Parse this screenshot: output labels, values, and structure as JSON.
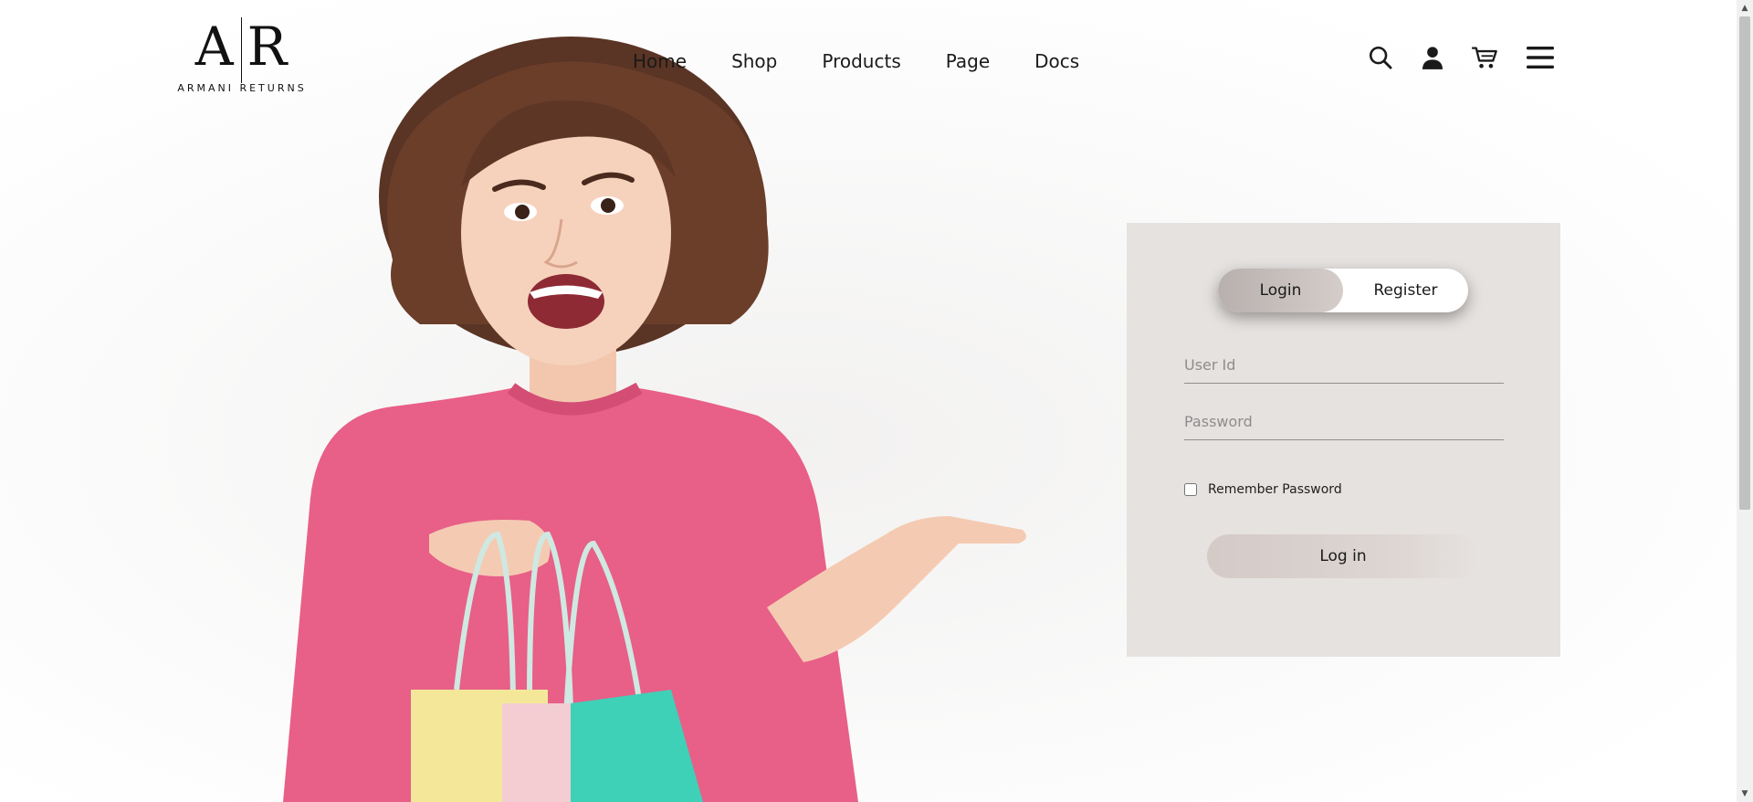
{
  "brand": {
    "mark_left": "A",
    "mark_right": "R",
    "name": "ARMANI RETURNS"
  },
  "nav": {
    "items": [
      "Home",
      "Shop",
      "Products",
      "Page",
      "Docs"
    ]
  },
  "header_icons": [
    "search-icon",
    "user-icon",
    "cart-icon",
    "menu-icon"
  ],
  "login_card": {
    "tabs": {
      "login": "Login",
      "register": "Register",
      "active": "login"
    },
    "user_id": {
      "value": "",
      "placeholder": "User Id"
    },
    "password": {
      "value": "",
      "placeholder": "Password"
    },
    "remember_label": "Remember Password",
    "remember_checked": false,
    "submit_label": "Log in"
  },
  "colors": {
    "card_background": "#e6e2e0",
    "active_tab": "#b7b0ae",
    "sweater": "#e85f87",
    "bag_yellow": "#f4e79a",
    "bag_pink": "#f3cdd2",
    "bag_teal": "#3fd0b8"
  }
}
